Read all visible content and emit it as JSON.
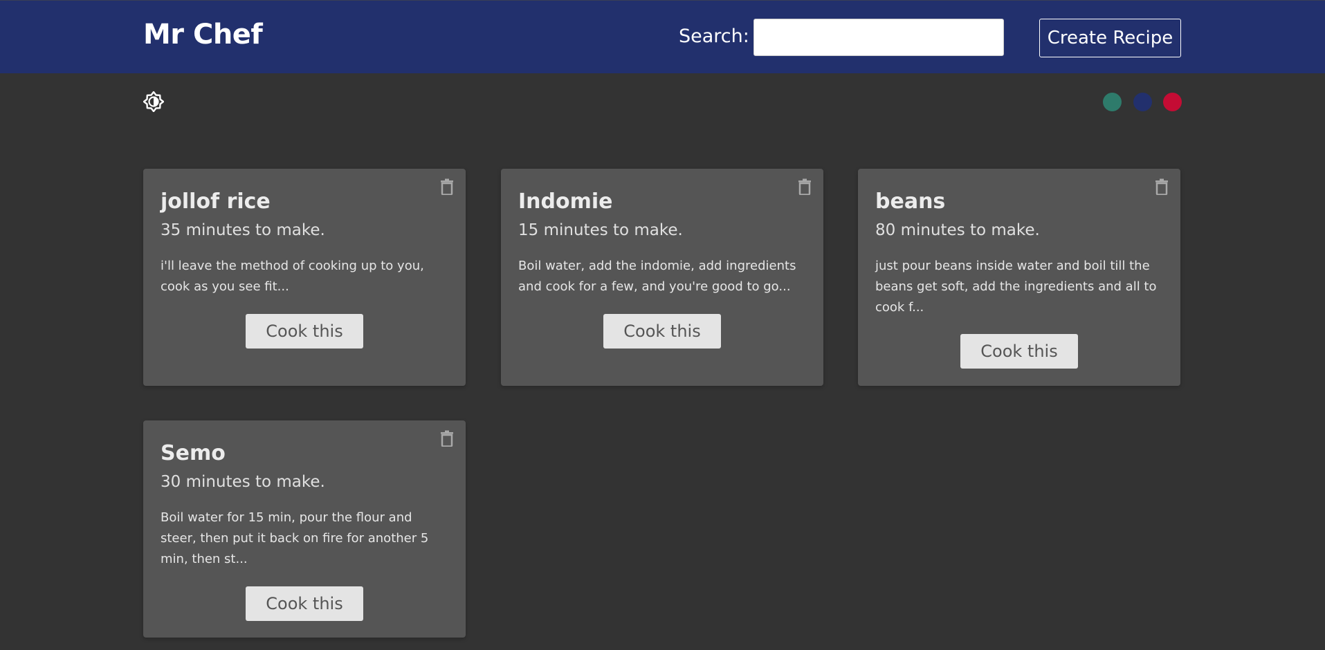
{
  "header": {
    "brand": "Mr Chef",
    "search_label": "Search:",
    "search_value": "",
    "create_label": "Create Recipe"
  },
  "toolbar": {
    "theme_toggle_icon": "brightness-toggle-icon",
    "color_options": [
      {
        "name": "teal",
        "color": "#2e7b6b"
      },
      {
        "name": "navy",
        "color": "#22306d"
      },
      {
        "name": "crimson",
        "color": "#c40c34"
      }
    ]
  },
  "recipes": [
    {
      "title": "jollof rice",
      "time": "35 minutes to make.",
      "description": "i'll leave the method of cooking up to you, cook as you see fit...",
      "button": "Cook this"
    },
    {
      "title": "Indomie",
      "time": "15 minutes to make.",
      "description": "Boil water, add the indomie, add ingredients and cook for a few, and you're good to go...",
      "button": "Cook this"
    },
    {
      "title": "beans",
      "time": "80 minutes to make.",
      "description": "just pour beans inside water and boil till the beans get soft, add the ingredients and all to cook f...",
      "button": "Cook this"
    },
    {
      "title": "Semo",
      "time": "30 minutes to make.",
      "description": "Boil water for 15 min, pour the flour and steer, then put it back on fire for another 5 min, then st...",
      "button": "Cook this"
    }
  ],
  "colors": {
    "navbar": "#22306d",
    "background": "#333333",
    "card": "#555555",
    "button": "#e4e4e4"
  }
}
